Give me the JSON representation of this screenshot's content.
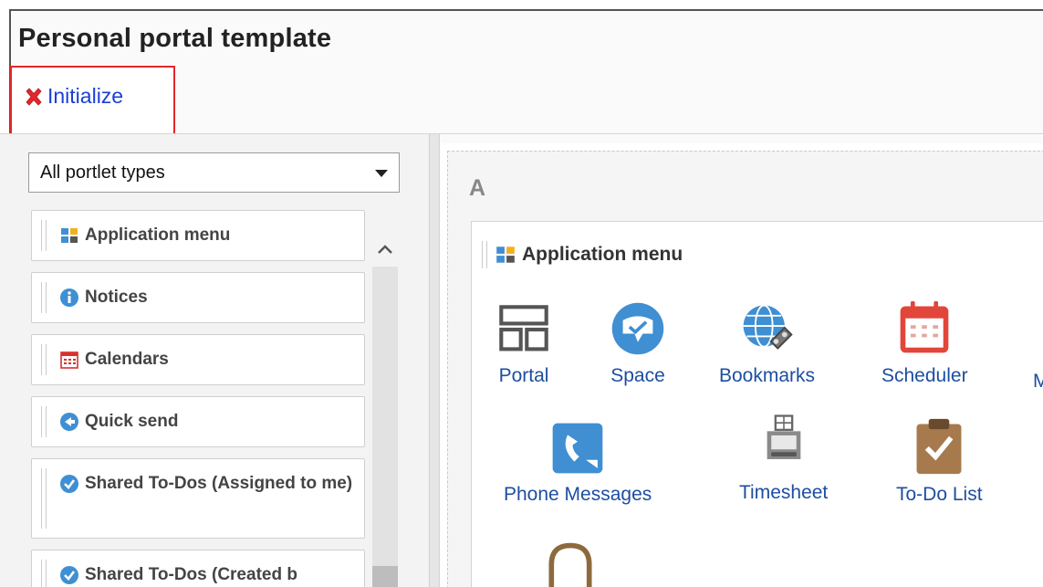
{
  "header": {
    "title": "Personal portal template",
    "initialize_label": "Initialize"
  },
  "palette": {
    "filter_value": "All portlet types",
    "items": [
      {
        "label": "Application menu",
        "icon": "app-menu-icon"
      },
      {
        "label": "Notices",
        "icon": "info-icon"
      },
      {
        "label": "Calendars",
        "icon": "calendar-icon"
      },
      {
        "label": "Quick send",
        "icon": "quick-send-icon"
      },
      {
        "label": "Shared To-Dos (Assigned to me)",
        "icon": "shared-todo-icon"
      },
      {
        "label": "Shared To-Dos (Created b",
        "icon": "shared-todo-icon"
      }
    ]
  },
  "layout": {
    "column_label": "A",
    "card_title": "Application menu",
    "apps": [
      {
        "label": "Portal",
        "icon": "portal-icon"
      },
      {
        "label": "Space",
        "icon": "space-icon"
      },
      {
        "label": "Bookmarks",
        "icon": "bookmarks-icon"
      },
      {
        "label": "Scheduler",
        "icon": "scheduler-icon"
      },
      {
        "label": "M",
        "icon": "truncated-app"
      },
      {
        "label": "Phone Messages",
        "icon": "phone-messages-icon"
      },
      {
        "label": "Timesheet",
        "icon": "timesheet-icon"
      },
      {
        "label": "To-Do List",
        "icon": "todo-list-icon"
      },
      {
        "label": "",
        "icon": "inbox-icon"
      }
    ]
  },
  "colors": {
    "highlight": "#e3262b",
    "link": "#1a3fd6",
    "app_label": "#1d4ea1",
    "icon_blue": "#3f8fd2"
  }
}
